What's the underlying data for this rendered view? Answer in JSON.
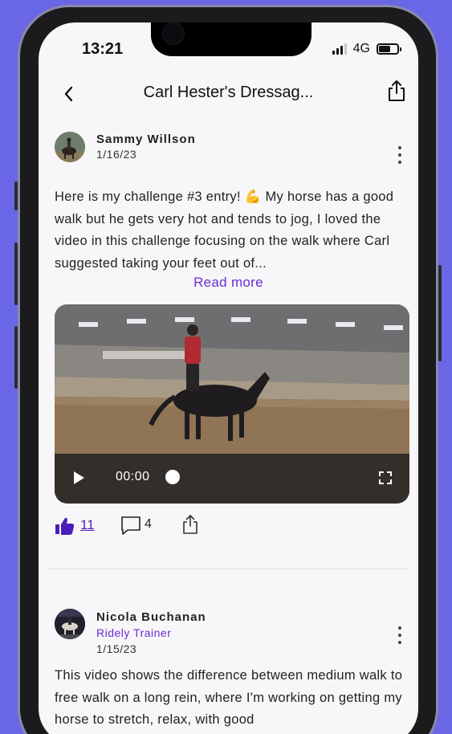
{
  "status_bar": {
    "time": "13:21",
    "network": "4G"
  },
  "nav": {
    "title": "Carl Hester's Dressag..."
  },
  "posts": [
    {
      "author": "Sammy Willson",
      "role": "",
      "date": "1/16/23",
      "text": "Here is my challenge #3 entry! 💪 My horse has a good walk but he gets very hot and tends to jog, I loved the video in this challenge focusing on the walk where Carl suggested taking your feet out of...",
      "read_more": "Read more",
      "video": {
        "time": "00:00"
      },
      "likes": "11",
      "comments": "4"
    },
    {
      "author": "Nicola Buchanan",
      "role": "Ridely Trainer",
      "date": "1/15/23",
      "text": "This video shows the difference between medium walk to free walk on a long rein, where I'm working on getting my horse to stretch, relax, with good"
    }
  ],
  "colors": {
    "accent": "#6a2ed4",
    "like": "#4b1fb5",
    "background": "#6a67e6"
  }
}
